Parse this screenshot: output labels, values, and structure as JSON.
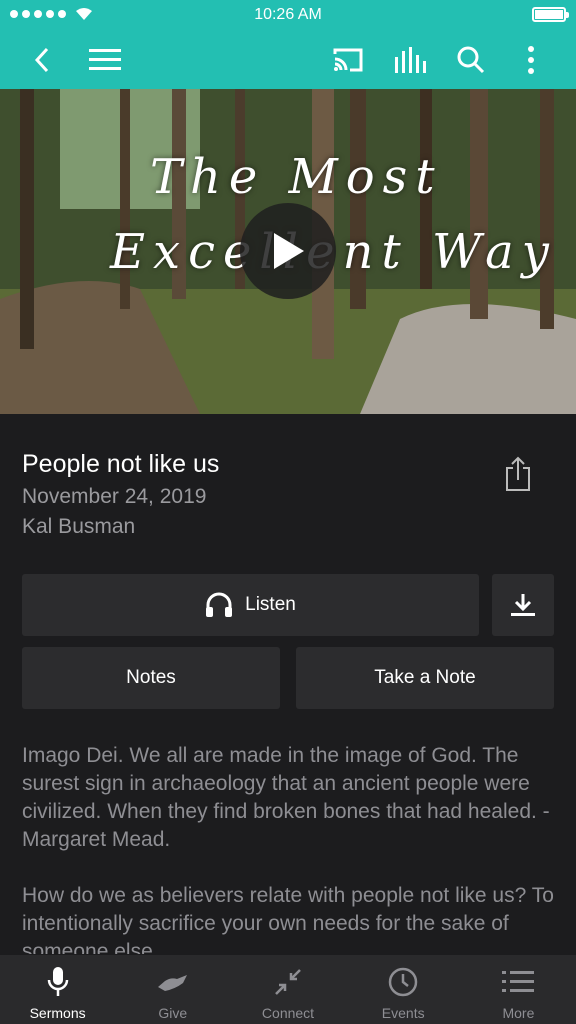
{
  "status_bar": {
    "time": "10:26 AM"
  },
  "nav": {
    "icons": [
      "back-icon",
      "menu-icon",
      "cast-icon",
      "equalizer-icon",
      "search-icon",
      "more-vertical-icon"
    ]
  },
  "hero": {
    "title_line1": "The Most",
    "title_line2": "Excellent Way",
    "play_icon": "play-icon"
  },
  "sermon": {
    "title": "People not like us",
    "date": "November 24, 2019",
    "speaker": "Kal Busman"
  },
  "actions": {
    "listen_label": "Listen",
    "notes_label": "Notes",
    "take_note_label": "Take a Note"
  },
  "description": {
    "paragraph1": "Imago Dei. We all are made in the image of God. The surest sign in archaeology that an ancient people were civilized. When they find broken bones that had healed. -Margaret Mead.",
    "paragraph2": "How do we as believers relate with people not like us? To intentionally sacrifice your own needs for the sake of someone else."
  },
  "tabs": [
    {
      "label": "Sermons",
      "icon": "microphone-icon",
      "active": true
    },
    {
      "label": "Give",
      "icon": "give-hand-icon",
      "active": false
    },
    {
      "label": "Connect",
      "icon": "connect-arrows-icon",
      "active": false
    },
    {
      "label": "Events",
      "icon": "clock-icon",
      "active": false
    },
    {
      "label": "More",
      "icon": "list-icon",
      "active": false
    }
  ],
  "colors": {
    "accent": "#23bfb2",
    "background": "#1c1c1e",
    "button": "#2c2c2e",
    "secondary_text": "#9a9a9e"
  }
}
